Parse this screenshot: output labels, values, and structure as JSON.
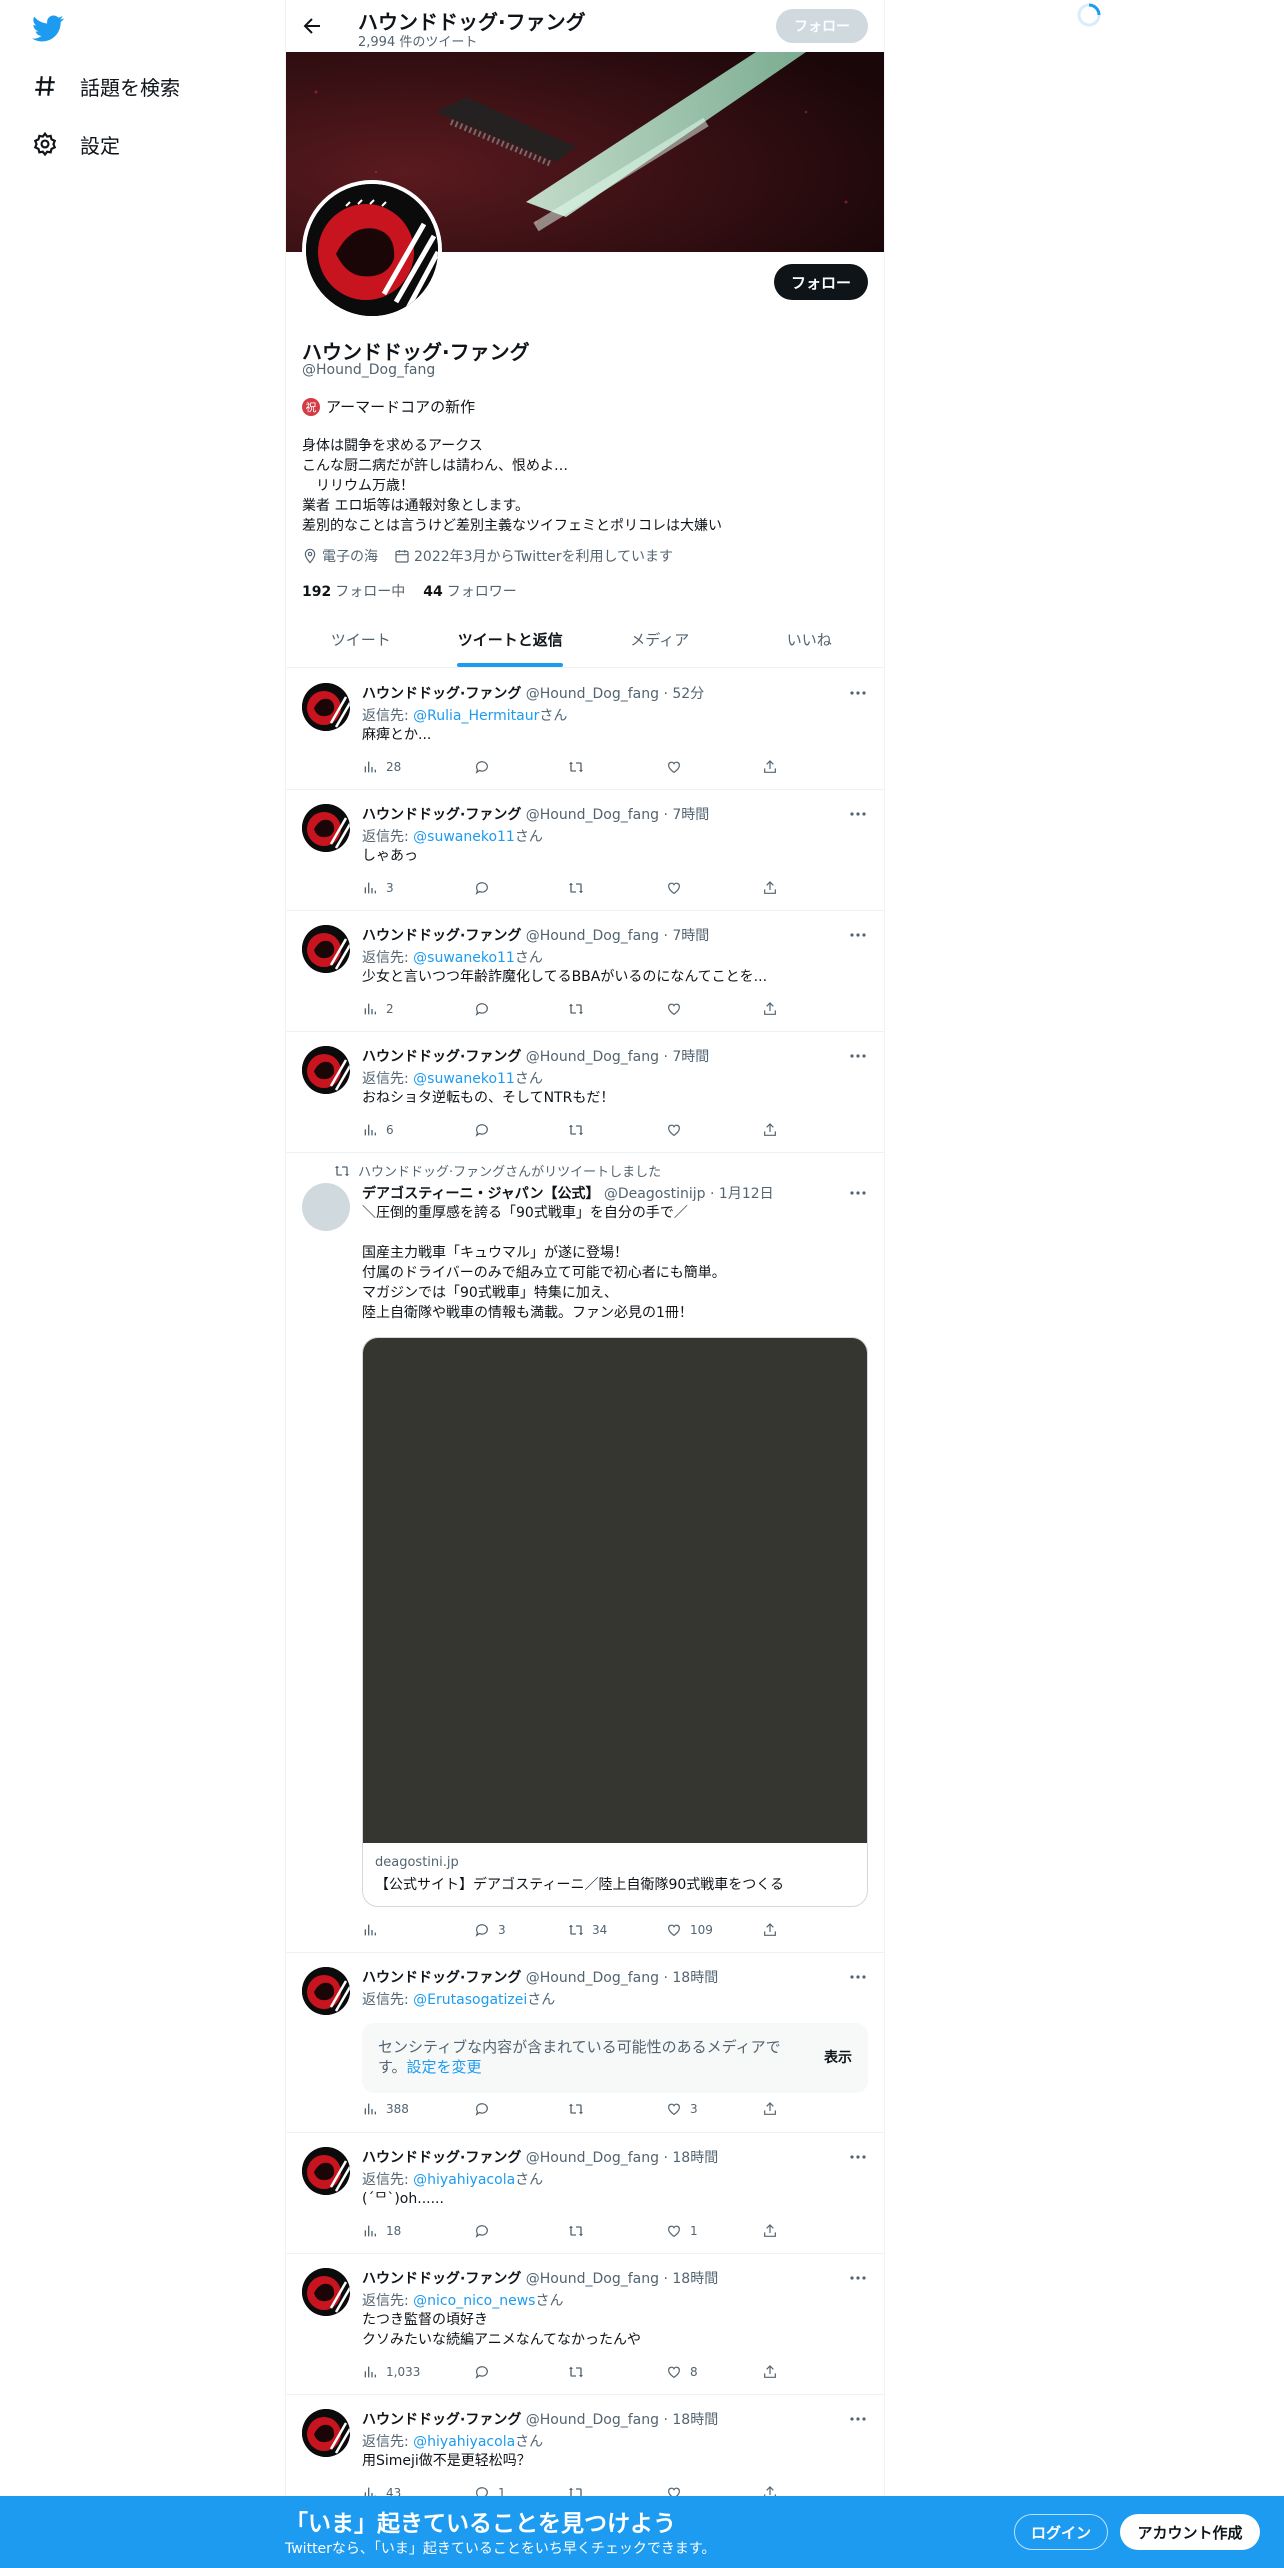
{
  "nav": {
    "explore_label": "話題を検索",
    "settings_label": "設定"
  },
  "header": {
    "title": "ハウンドドッグ·ファング",
    "tweet_count": "2,994 件のツイート",
    "follow_label": "フォロー"
  },
  "profile": {
    "follow_label": "フォロー",
    "name": "ハウンドドッグ·ファング",
    "handle": "@Hound_Dog_fang",
    "tagline_emoji": "祝",
    "tagline": "アーマードコアの新作",
    "bio": [
      "身体は闘争を求めるアークス",
      "こんな厨二病だが許しは請わん、恨めよ…",
      "　リリウム万歳！",
      "業者 エロ垢等は通報対象とします。",
      "差別的なことは言うけど差別主義なツイフェミとポリコレは大嫌い"
    ],
    "location": "電子の海",
    "joined": "2022年3月からTwitterを利用しています",
    "following_count": "192",
    "following_label": "フォロー中",
    "followers_count": "44",
    "followers_label": "フォロワー"
  },
  "tabs": [
    {
      "label": "ツイート"
    },
    {
      "label": "ツイートと返信"
    },
    {
      "label": "メディア"
    },
    {
      "label": "いいね"
    }
  ],
  "tweets": [
    {
      "name": "ハウンドドッグ·ファング",
      "handle": "@Hound_Dog_fang",
      "time": "52分",
      "reply_prefix": "返信先: ",
      "reply_to": "@Rulia_Hermitaur",
      "reply_suffix": "さん",
      "text": [
        "麻痺とか..."
      ],
      "views": "28",
      "replies": "",
      "retweets": "",
      "likes": ""
    },
    {
      "name": "ハウンドドッグ·ファング",
      "handle": "@Hound_Dog_fang",
      "time": "7時間",
      "reply_prefix": "返信先: ",
      "reply_to": "@suwaneko11",
      "reply_suffix": "さん",
      "text": [
        "しゃあっ"
      ],
      "views": "3",
      "replies": "",
      "retweets": "",
      "likes": ""
    },
    {
      "name": "ハウンドドッグ·ファング",
      "handle": "@Hound_Dog_fang",
      "time": "7時間",
      "reply_prefix": "返信先: ",
      "reply_to": "@suwaneko11",
      "reply_suffix": "さん",
      "text": [
        "少女と言いつつ年齢詐魔化してるBBAがいるのになんてことを..."
      ],
      "views": "2",
      "replies": "",
      "retweets": "",
      "likes": ""
    },
    {
      "name": "ハウンドドッグ·ファング",
      "handle": "@Hound_Dog_fang",
      "time": "7時間",
      "reply_prefix": "返信先: ",
      "reply_to": "@suwaneko11",
      "reply_suffix": "さん",
      "text": [
        "おねショタ逆転もの、そしてNTRもだ！"
      ],
      "views": "6",
      "replies": "",
      "retweets": "",
      "likes": ""
    },
    {
      "retweet_label": "ハウンドドッグ·ファングさんがリツイートしました",
      "name": "デアゴスティーニ・ジャパン【公式】",
      "handle": "@Deagostinijp",
      "time": "1月12日",
      "text": [
        "＼圧倒的重厚感を誇る「90式戦車」を自分の手で／",
        "",
        "国産主力戦車「キュウマル」が遂に登場！",
        "付属のドライバーのみで組み立て可能で初心者にも簡単。",
        "マガジンでは「90式戦車」特集に加え、",
        "陸上自衛隊や戦車の情報も満載。ファン必見の1冊！"
      ],
      "card_domain": "deagostini.jp",
      "card_title": "【公式サイト】デアゴスティーニ／陸上自衛隊90式戦車をつくる",
      "views": "",
      "replies": "3",
      "retweets": "34",
      "likes": "109"
    },
    {
      "name": "ハウンドドッグ·ファング",
      "handle": "@Hound_Dog_fang",
      "time": "18時間",
      "reply_prefix": "返信先: ",
      "reply_to": "@Erutasogatizei",
      "reply_suffix": "さん",
      "sensitive_text": "センシティブな内容が含まれている可能性のあるメディアです。",
      "sensitive_link": "設定を変更",
      "sensitive_button": "表示",
      "views": "388",
      "replies": "",
      "retweets": "",
      "likes": "3"
    },
    {
      "name": "ハウンドドッグ·ファング",
      "handle": "@Hound_Dog_fang",
      "time": "18時間",
      "reply_prefix": "返信先: ",
      "reply_to": "@hiyahiyacola",
      "reply_suffix": "さん",
      "text": [
        "(´ᄆ`)oh......"
      ],
      "views": "18",
      "replies": "",
      "retweets": "",
      "likes": "1"
    },
    {
      "name": "ハウンドドッグ·ファング",
      "handle": "@Hound_Dog_fang",
      "time": "18時間",
      "reply_prefix": "返信先: ",
      "reply_to": "@nico_nico_news",
      "reply_suffix": "さん",
      "text": [
        "たつき監督の頃好き",
        "クソみたいな続編アニメなんてなかったんや"
      ],
      "views": "1,033",
      "replies": "",
      "retweets": "",
      "likes": "8"
    },
    {
      "name": "ハウンドドッグ·ファング",
      "handle": "@Hound_Dog_fang",
      "time": "18時間",
      "reply_prefix": "返信先: ",
      "reply_to": "@hiyahiyacola",
      "reply_suffix": "さん",
      "text": [
        "用Simeji做不是更轻松吗？"
      ],
      "views": "43",
      "replies": "1",
      "retweets": "",
      "likes": ""
    }
  ],
  "bottom_bar": {
    "title": "「いま」起きていることを見つけよう",
    "subtitle": "Twitterなら、「いま」起きていることをいち早くチェックできます。",
    "login_label": "ログイン",
    "signup_label": "アカウント作成"
  },
  "colors": {
    "accent": "#1d9bf0",
    "text": "#0f1419",
    "muted": "#536471"
  }
}
